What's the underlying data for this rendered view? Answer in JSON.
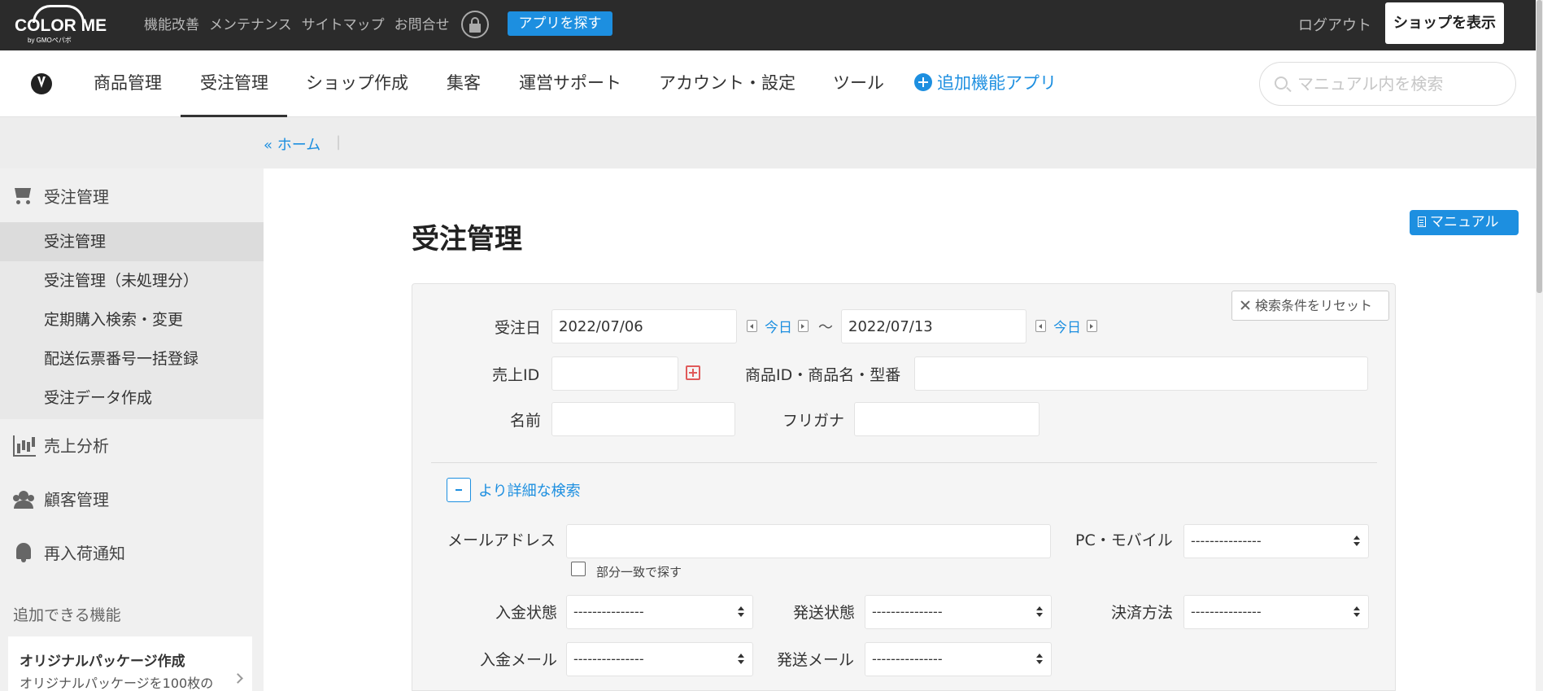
{
  "topbar": {
    "logo": {
      "name": "COLOR ME",
      "byline": "by GMOペパボ"
    },
    "links": [
      "機能改善",
      "メンテナンス",
      "サイトマップ",
      "お問合せ"
    ],
    "find_app_label": "アプリを探す",
    "logout_label": "ログアウト",
    "show_shop_label": "ショップを表示"
  },
  "mainnav": {
    "items": [
      "商品管理",
      "受注管理",
      "ショップ作成",
      "集客",
      "運営サポート",
      "アカウント・設定",
      "ツール"
    ],
    "active": "受注管理",
    "addon_label": "追加機能アプリ",
    "search_placeholder": "マニュアル内を検索"
  },
  "breadcrumb": {
    "home_label": "« ホーム",
    "separator": "|"
  },
  "sidebar": {
    "order_mgmt": {
      "title": "受注管理",
      "items": [
        "受注管理",
        "受注管理（未処理分）",
        "定期購入検索・変更",
        "配送伝票番号一括登録",
        "受注データ作成"
      ],
      "active_index": 0
    },
    "sales_analysis": "売上分析",
    "customer_mgmt": "顧客管理",
    "restock_notice": "再入荷通知",
    "addable_features_label": "追加できる機能",
    "feature_card": {
      "title": "オリジナルパッケージ作成",
      "desc": "オリジナルパッケージを100枚の"
    }
  },
  "main": {
    "page_title": "受注管理",
    "manual_label": "マニュアル",
    "reset_label": "検索条件をリセット",
    "form": {
      "order_date_label": "受注日",
      "date_from": "2022/07/06",
      "date_to": "2022/07/13",
      "today_label": "今日",
      "tilde": "〜",
      "sales_id_label": "売上ID",
      "sales_id_value": "",
      "product_label": "商品ID・商品名・型番",
      "product_value": "",
      "name_label": "名前",
      "name_value": "",
      "kana_label": "フリガナ",
      "kana_value": "",
      "detail_toggle_label": "より詳細な検索",
      "email_label": "メールアドレス",
      "email_value": "",
      "partial_match_label": "部分一致で探す",
      "device_label": "PC・モバイル",
      "payment_status_label": "入金状態",
      "shipping_status_label": "発送状態",
      "payment_method_label": "決済方法",
      "payment_mail_label": "入金メール",
      "shipping_mail_label": "発送メール",
      "select_default": "---------------"
    }
  },
  "colors": {
    "accent": "#1d8fe0",
    "topbar_bg": "#2b2b2b",
    "sidebar_bg": "#f0f0f0",
    "danger_plus": "#e05a5a"
  }
}
